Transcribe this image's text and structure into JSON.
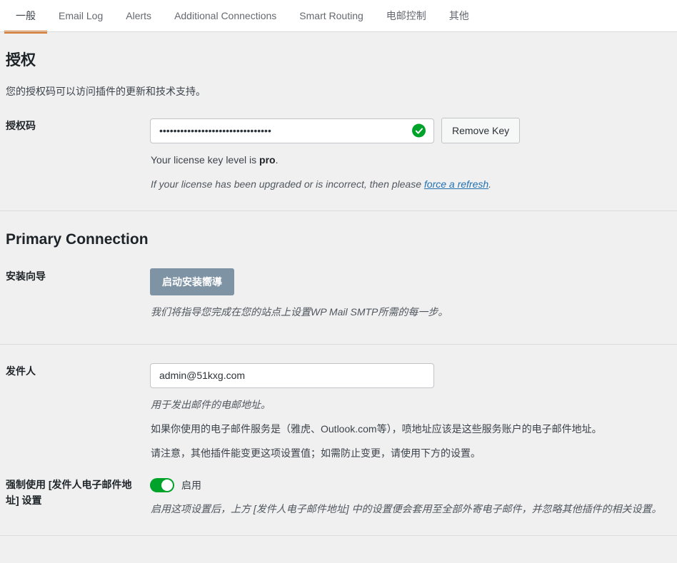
{
  "tabs": [
    {
      "label": "一般",
      "active": true
    },
    {
      "label": "Email Log",
      "active": false
    },
    {
      "label": "Alerts",
      "active": false
    },
    {
      "label": "Additional Connections",
      "active": false
    },
    {
      "label": "Smart Routing",
      "active": false
    },
    {
      "label": "电邮控制",
      "active": false
    },
    {
      "label": "其他",
      "active": false
    }
  ],
  "license": {
    "title": "授权",
    "description": "您的授权码可以访问插件的更新和技术支持。",
    "field_label": "授权码",
    "key_value": "••••••••••••••••••••••••••••••••",
    "key_masked_char": "•",
    "valid_icon": "check-circle-icon",
    "remove_button": "Remove Key",
    "level_prefix": "Your license key level is ",
    "level_value": "pro",
    "level_suffix": ".",
    "refresh_prefix": "If your license has been upgraded or is incorrect, then please ",
    "refresh_link": "force a refresh",
    "refresh_suffix": "."
  },
  "primary_connection": {
    "title": "Primary Connection",
    "wizard_label": "安装向导",
    "wizard_button": "启动安装嚮導",
    "wizard_help": "我们将指导您完成在您的站点上设置WP Mail SMTP所需的每一步。"
  },
  "from_email": {
    "label": "发件人",
    "value": "admin@51kxg.com",
    "help_1": "用于发出邮件的电邮地址。",
    "help_2": "如果你使用的电子邮件服务是（雅虎、Outlook.com等），喷地址应该是这些服务账户的电子邮件地址。",
    "help_3": "请注意，其他插件能变更这项设置值；如需防止变更，请使用下方的设置。"
  },
  "force_from_email": {
    "label": "强制使用 [发件人电子邮件地址] 设置",
    "toggle_state": "on",
    "toggle_label": "启用",
    "help": "启用这项设置后，上方 [发件人电子邮件地址] 中的设置便会套用至全部外寄电子邮件，并忽略其他插件的相关设置。"
  },
  "colors": {
    "accent": "#d4762a",
    "success": "#00a32a",
    "button_gray": "#7e93a4",
    "link": "#2271b1",
    "background": "#f0f0f1"
  }
}
